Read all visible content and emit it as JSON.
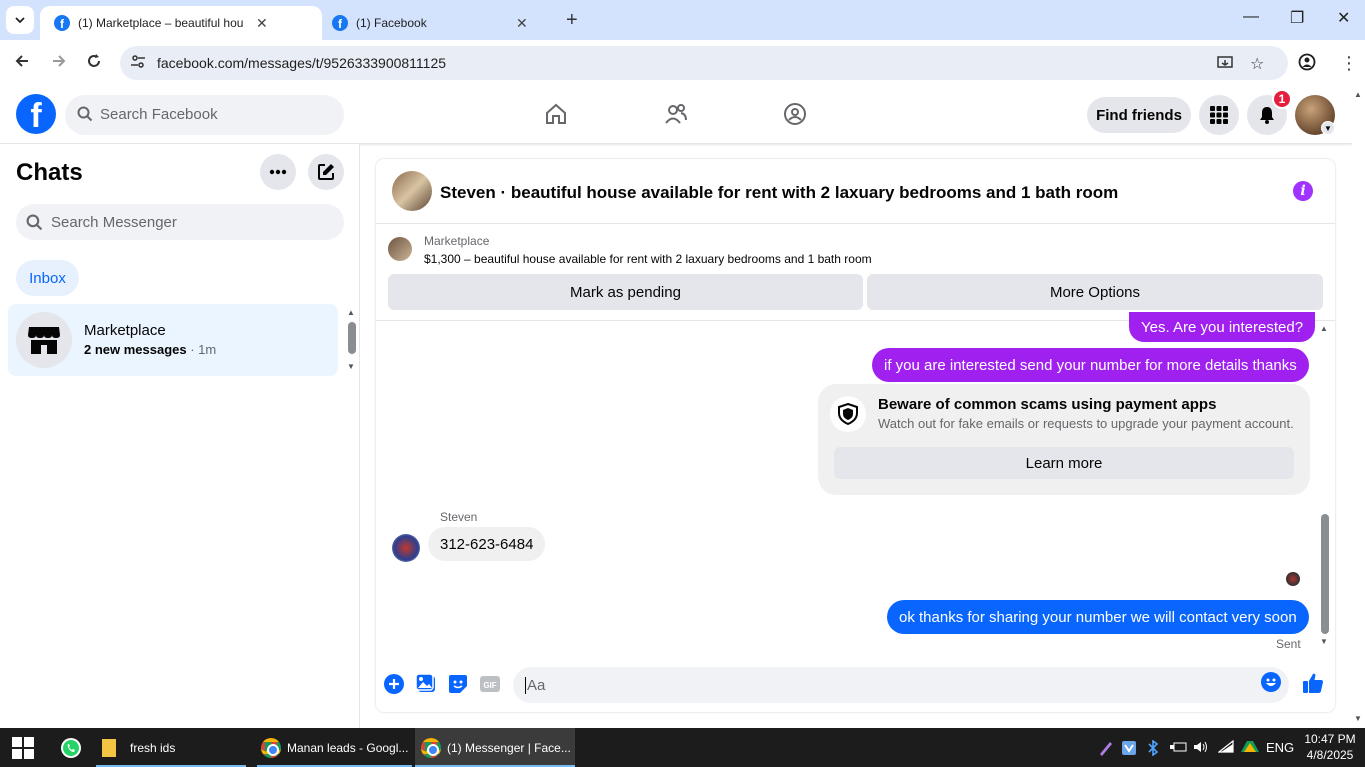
{
  "browser": {
    "tabs": [
      {
        "title": "(1) Marketplace – beautiful hou",
        "active": true
      },
      {
        "title": "(1) Facebook",
        "active": false
      }
    ],
    "url": "facebook.com/messages/t/9526333900811125"
  },
  "fb_header": {
    "search_placeholder": "Search Facebook",
    "find_friends": "Find friends",
    "notification_count": "1"
  },
  "sidebar": {
    "title": "Chats",
    "search_placeholder": "Search Messenger",
    "inbox": "Inbox",
    "chats": [
      {
        "name": "Marketplace",
        "preview": "2 new messages",
        "time": " · 1m"
      }
    ]
  },
  "conversation": {
    "title": "Steven · beautiful house available for rent with 2 laxuary bedrooms and 1 bath room",
    "marketplace_label": "Marketplace",
    "listing": "$1,300 – beautiful house available for rent with 2 laxuary bedrooms and 1 bath room",
    "mark_pending": "Mark as pending",
    "more_options": "More Options",
    "messages": {
      "m1": "Yes. Are you interested?",
      "m2": "if you are interested send your number for more details thanks",
      "steven_label": "Steven",
      "m3": "312-623-6484",
      "m4": "ok thanks for sharing your number we will contact very soon",
      "status": "Sent"
    },
    "scam_notice": {
      "title": "Beware of common scams using payment apps",
      "subtitle": "Watch out for fake emails or requests to upgrade your payment account.",
      "button": "Learn more"
    },
    "composer_placeholder": "Aa",
    "colors": {
      "purple": "#a020f0",
      "blue": "#0866ff"
    }
  },
  "taskbar": {
    "items": [
      {
        "label": "fresh ids"
      },
      {
        "label": "Manan leads - Googl..."
      },
      {
        "label": "(1) Messenger | Face..."
      }
    ],
    "language": "ENG",
    "time": "10:47 PM",
    "date": "4/8/2025"
  }
}
